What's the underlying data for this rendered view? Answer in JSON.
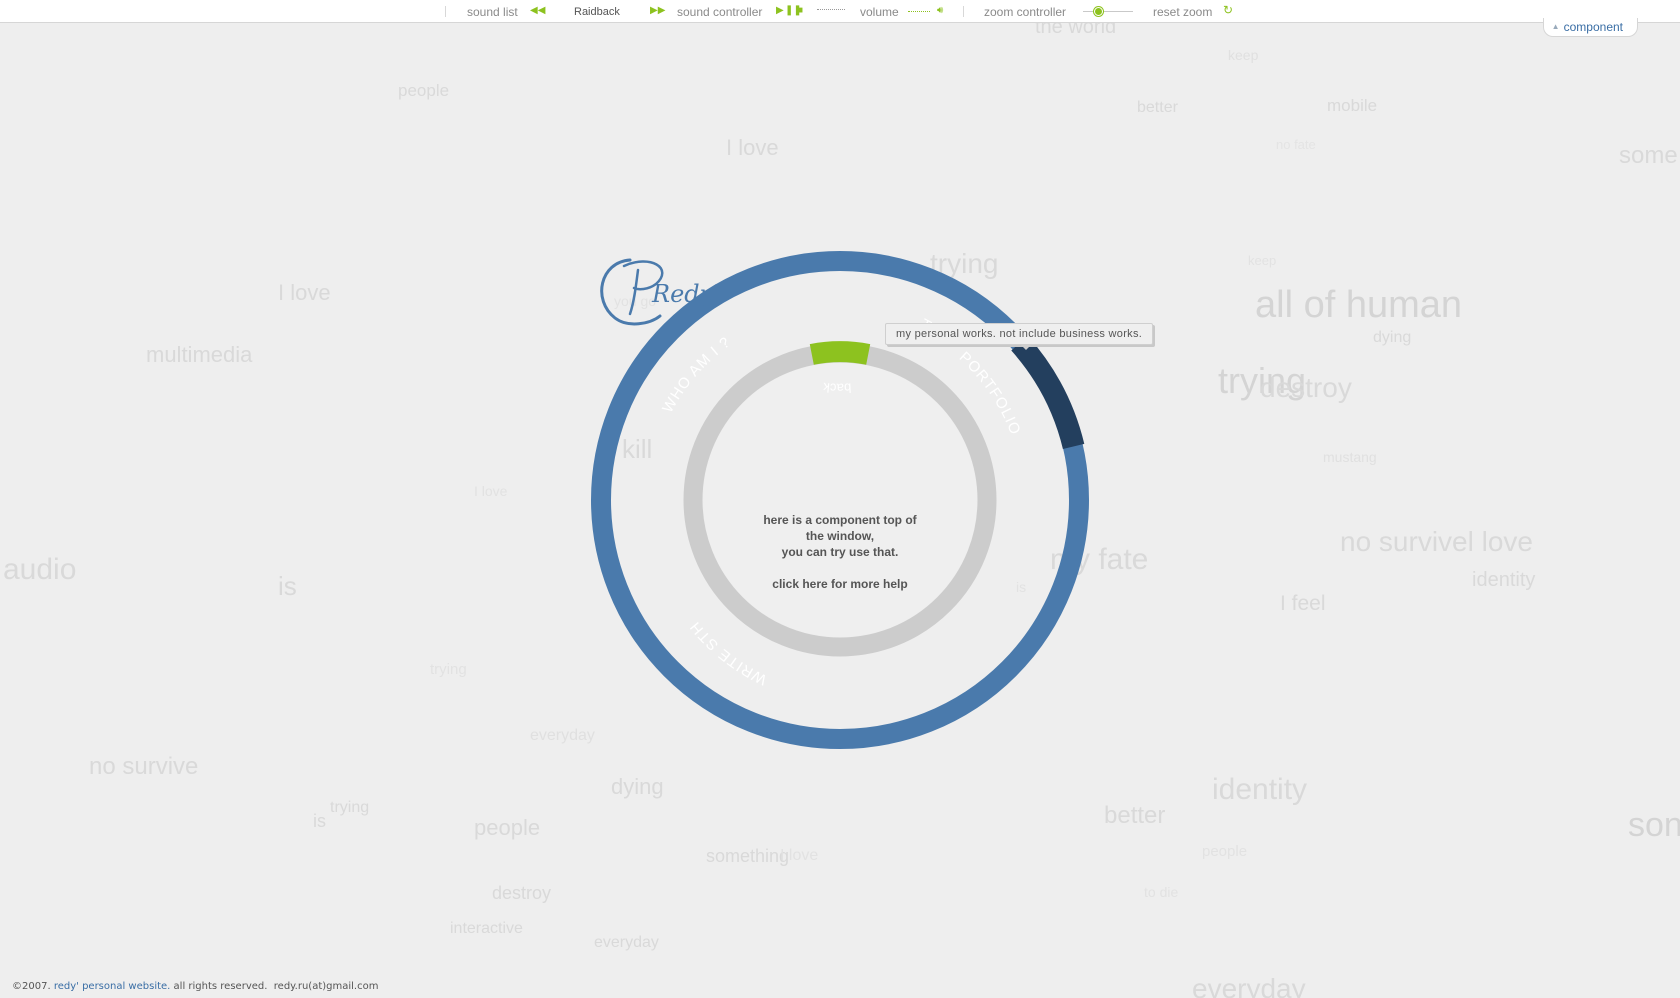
{
  "toolbar": {
    "sound_list_label": "sound list",
    "track_name": "Raidback",
    "sound_controller_label": "sound controller",
    "volume_label": "volume",
    "zoom_controller_label": "zoom controller",
    "reset_zoom_label": "reset zoom",
    "icons": {
      "prev": "rewind-icon",
      "next": "fast-forward-icon",
      "play": "play-icon",
      "pause": "pause-icon",
      "stop": "stop-icon",
      "speaker": "speaker-icon",
      "refresh": "refresh-icon"
    },
    "accent_color": "#8dc21f"
  },
  "component_tab": {
    "label": "component"
  },
  "menu": {
    "ring_color": "#4a7aac",
    "active_color": "#233f5e",
    "items": [
      "WHO AM I ?",
      "PORTFOLIO",
      "CONTACT",
      "WRITE STH"
    ],
    "active_item": "PORTFOLIO",
    "back_label": "back",
    "back_color": "#8dc21f"
  },
  "center": {
    "logo_text": "Redy'",
    "help_lines": [
      "here is a component top of",
      "the window,",
      "you can try use that."
    ],
    "more_help": "click here for more help"
  },
  "tooltip": {
    "text": "my personal works. not include business works."
  },
  "footer": {
    "copyright": "©2007.",
    "site_link": "redy' personal website.",
    "rights": "all rights reserved.",
    "email": "redy.ru(at)gmail.com"
  },
  "background_words": [
    "the world",
    "keep",
    "people",
    "better",
    "mobile",
    "I love",
    "no fate",
    "some",
    "trying",
    "keep",
    "all of human",
    "I love",
    "dying",
    "multimedia",
    "you go",
    "trying",
    "destroy",
    "trying",
    "kill",
    "mustang",
    "is",
    "I love",
    "audio",
    "my fate",
    "no survivel love",
    "is",
    "identity",
    "I feel",
    "everyday",
    "trying",
    "no survive",
    "dying",
    "trying",
    "identity",
    "is",
    "people",
    "better",
    "son",
    "something",
    "I love",
    "people",
    "destroy",
    "to die",
    "interactive",
    "everyday",
    "everyday"
  ]
}
